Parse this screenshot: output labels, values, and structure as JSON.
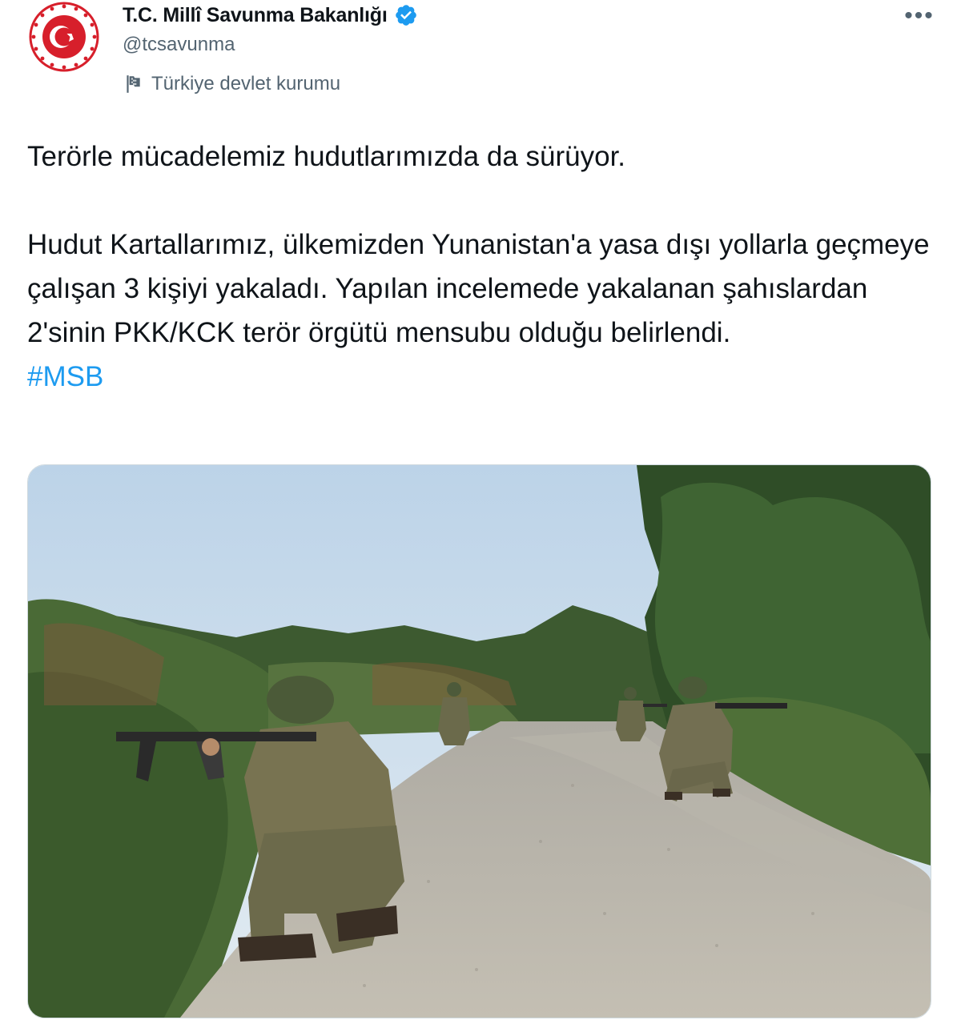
{
  "account": {
    "display_name": "T.C. Millî Savunma Bakanlığı",
    "handle": "@tcsavunma",
    "label": "Türkiye devlet kurumu",
    "verified": true,
    "avatar_icon": "ministry-emblem-icon"
  },
  "menu": {
    "more_icon": "more-horizontal-icon",
    "more_glyph": "•••"
  },
  "tweet": {
    "paragraph1": "Terörle mücadelemiz hudutlarımızda da sürüyor.",
    "paragraph2": "Hudut Kartallarımız, ülkemizden Yunanistan'a yasa dışı yollarla geçmeye çalışan 3 kişiyi yakaladı. Yapılan incelemede yakalanan şahıslardan 2'sinin PKK/KCK terör örgütü mensubu olduğu belirlendi.",
    "hashtag": "#MSB"
  },
  "media": {
    "description_icon": "photo-soldiers-on-dirt-road",
    "colors": {
      "sky": "#cfe0ee",
      "road": "#b7b3a9",
      "vegetation": "#4d6b3a",
      "uniform": "#6c6a4e"
    }
  },
  "colors": {
    "link": "#1d9bf0",
    "verified": "#1d9bf0",
    "secondary_text": "#536471",
    "emblem": "#d71f2b"
  }
}
